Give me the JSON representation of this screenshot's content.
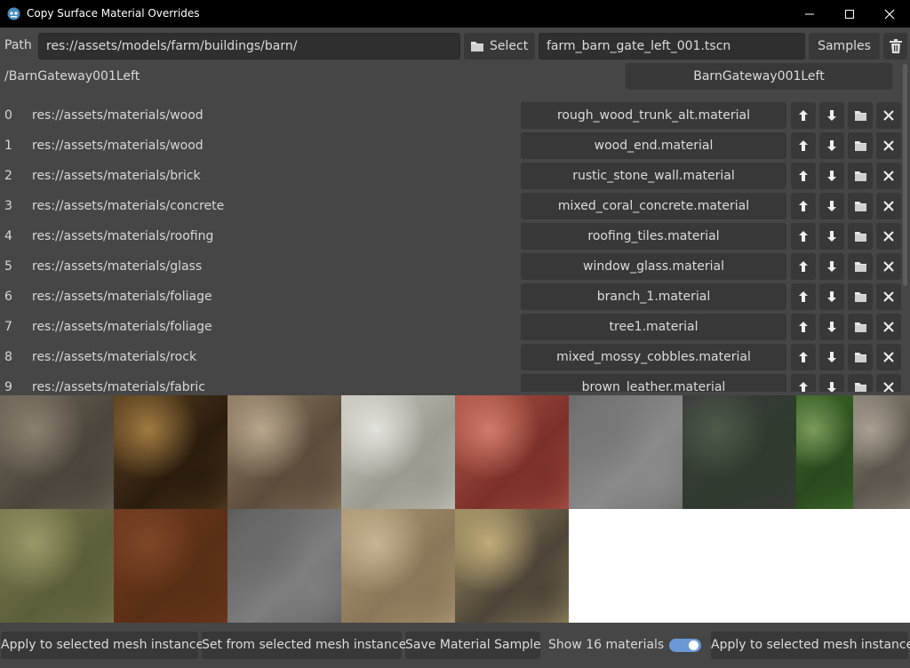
{
  "window": {
    "title": "Copy Surface Material Overrides"
  },
  "toolbar": {
    "path_label": "Path",
    "path_value": "res://assets/models/farm/buildings/barn/",
    "select_label": "Select",
    "scene_value": "farm_barn_gate_left_001.tscn",
    "samples_label": "Samples"
  },
  "node": {
    "path": "/BarnGateway001Left",
    "button_label": "BarnGateway001Left"
  },
  "materials": [
    {
      "index": "0",
      "path": "res://assets/materials/wood",
      "material": "rough_wood_trunk_alt.material"
    },
    {
      "index": "1",
      "path": "res://assets/materials/wood",
      "material": "wood_end.material"
    },
    {
      "index": "2",
      "path": "res://assets/materials/brick",
      "material": "rustic_stone_wall.material"
    },
    {
      "index": "3",
      "path": "res://assets/materials/concrete",
      "material": "mixed_coral_concrete.material"
    },
    {
      "index": "4",
      "path": "res://assets/materials/roofing",
      "material": "roofing_tiles.material"
    },
    {
      "index": "5",
      "path": "res://assets/materials/glass",
      "material": "window_glass.material"
    },
    {
      "index": "6",
      "path": "res://assets/materials/foliage",
      "material": "branch_1.material"
    },
    {
      "index": "7",
      "path": "res://assets/materials/foliage",
      "material": "tree1.material"
    },
    {
      "index": "8",
      "path": "res://assets/materials/rock",
      "material": "mixed_mossy_cobbles.material"
    },
    {
      "index": "9",
      "path": "res://assets/materials/fabric",
      "material": "brown_leather.material"
    }
  ],
  "swatches": [
    {
      "name": "weathered-wood-swatch",
      "colors": [
        "#6e6659",
        "#4a443a",
        "#8a8170"
      ]
    },
    {
      "name": "wood-end-swatch",
      "colors": [
        "#5a4020",
        "#2a1c0e",
        "#a07a40"
      ]
    },
    {
      "name": "stone-wall-swatch",
      "colors": [
        "#8e7b62",
        "#5b4c3b",
        "#b8a78d"
      ]
    },
    {
      "name": "coral-concrete-swatch",
      "colors": [
        "#c8c8c0",
        "#9a9a90",
        "#e2e2dc"
      ]
    },
    {
      "name": "roof-tiles-swatch",
      "colors": [
        "#b0564a",
        "#7a3028",
        "#d07a6c"
      ]
    },
    {
      "name": "window-glass-swatch",
      "colors": [
        "#6a6a6a",
        "#8a8a8a",
        "#777777"
      ]
    },
    {
      "name": "branch-swatch",
      "colors": [
        "#3c3c3c",
        "#2f3a2e",
        "#4d5a48"
      ]
    },
    {
      "name": "tree-foliage-swatch",
      "colors": [
        "#3e6a2a",
        "#2a4a1e",
        "#7a9a5a"
      ]
    },
    {
      "name": "bark-swatch",
      "colors": [
        "#8a8276",
        "#5c564c",
        "#a8a092"
      ]
    },
    {
      "name": "mossy-ground-swatch",
      "colors": [
        "#7a7a50",
        "#5c5e3a",
        "#9a9868"
      ]
    },
    {
      "name": "brown-leather-swatch",
      "colors": [
        "#6e3a1e",
        "#5a2e16",
        "#7e4626"
      ]
    },
    {
      "name": "grey-gradient-swatch",
      "colors": [
        "#5a5a5a",
        "#7e7e7e",
        "#6a6a6a"
      ]
    },
    {
      "name": "sandstone-brick-swatch",
      "colors": [
        "#b09a78",
        "#8a7658",
        "#c8b494"
      ]
    },
    {
      "name": "yellow-brick-swatch",
      "colors": [
        "#a08e62",
        "#4c4438",
        "#c0aa78"
      ]
    }
  ],
  "bottom": {
    "apply_left_label": "Apply to selected mesh instance",
    "set_from_label": "Set from selected mesh instance",
    "save_sample_label": "Save Material Sample",
    "show_label": "Show 16 materials",
    "show_toggle_on": true,
    "apply_right_label": "Apply to selected mesh instance"
  },
  "colors": {
    "background": "#464646",
    "button": "#383838",
    "field": "#2f2f2f",
    "accent": "#6b99d6"
  }
}
